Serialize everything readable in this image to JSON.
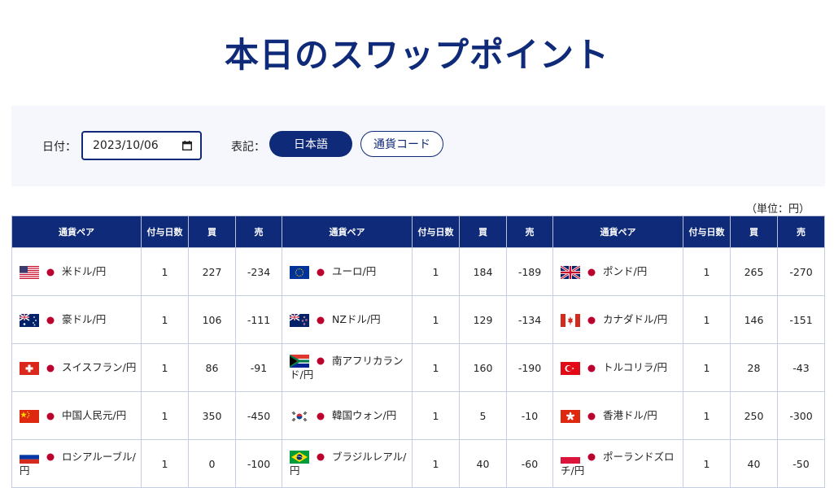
{
  "page": {
    "title": "本日のスワップポイント"
  },
  "controls": {
    "date_label": "日付：",
    "date_value": "2023/10/06",
    "display_label": "表記：",
    "toggle_japanese": "日本語",
    "toggle_code": "通貨コード"
  },
  "unit_note": "（単位：円）",
  "table": {
    "headers": [
      "通貨ペア",
      "付与日数",
      "買",
      "売"
    ],
    "rows": [
      [
        {
          "flag": "us-flag-icon",
          "pair": "米ドル/円",
          "days": "1",
          "buy": "227",
          "sell": "-234"
        },
        {
          "flag": "eu-flag-icon",
          "pair": "ユーロ/円",
          "days": "1",
          "buy": "184",
          "sell": "-189"
        },
        {
          "flag": "uk-flag-icon",
          "pair": "ポンド/円",
          "days": "1",
          "buy": "265",
          "sell": "-270"
        }
      ],
      [
        {
          "flag": "au-flag-icon",
          "pair": "豪ドル/円",
          "days": "1",
          "buy": "106",
          "sell": "-111"
        },
        {
          "flag": "nz-flag-icon",
          "pair": "NZドル/円",
          "days": "1",
          "buy": "129",
          "sell": "-134"
        },
        {
          "flag": "ca-flag-icon",
          "pair": "カナダドル/円",
          "days": "1",
          "buy": "146",
          "sell": "-151"
        }
      ],
      [
        {
          "flag": "ch-flag-icon",
          "pair": "スイスフラン/円",
          "days": "1",
          "buy": "86",
          "sell": "-91"
        },
        {
          "flag": "za-flag-icon",
          "pair": "南アフリカランド/円",
          "days": "1",
          "buy": "160",
          "sell": "-190"
        },
        {
          "flag": "tr-flag-icon",
          "pair": "トルコリラ/円",
          "days": "1",
          "buy": "28",
          "sell": "-43"
        }
      ],
      [
        {
          "flag": "cn-flag-icon",
          "pair": "中国人民元/円",
          "days": "1",
          "buy": "350",
          "sell": "-450"
        },
        {
          "flag": "kr-flag-icon",
          "pair": "韓国ウォン/円",
          "days": "1",
          "buy": "5",
          "sell": "-10"
        },
        {
          "flag": "hk-flag-icon",
          "pair": "香港ドル/円",
          "days": "1",
          "buy": "250",
          "sell": "-300"
        }
      ],
      [
        {
          "flag": "ru-flag-icon",
          "pair": "ロシアルーブル/円",
          "days": "1",
          "buy": "0",
          "sell": "-100"
        },
        {
          "flag": "br-flag-icon",
          "pair": "ブラジルレアル/円",
          "days": "1",
          "buy": "40",
          "sell": "-60"
        },
        {
          "flag": "pl-flag-icon",
          "pair": "ポーランドズロチ/円",
          "days": "1",
          "buy": "40",
          "sell": "-50"
        }
      ]
    ]
  }
}
